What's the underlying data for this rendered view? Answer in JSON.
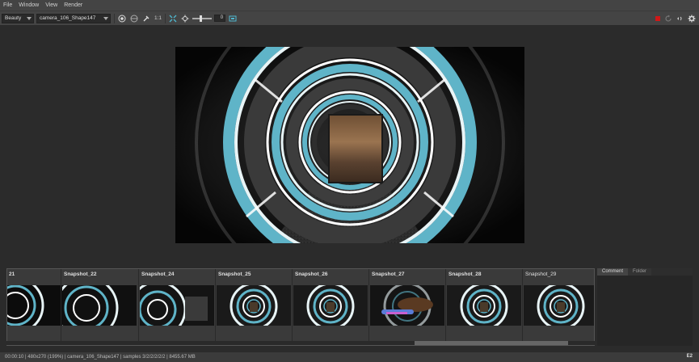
{
  "menu": {
    "items": [
      {
        "label": "File"
      },
      {
        "label": "Window"
      },
      {
        "label": "View"
      },
      {
        "label": "Render"
      }
    ]
  },
  "toolbar": {
    "aov_select": "Beauty",
    "camera_select": "camera_106_Shape147",
    "ratio_label": "1:1",
    "exposure_value": "0"
  },
  "snapshots": [
    {
      "label": "21"
    },
    {
      "label": "Snapshot_22"
    },
    {
      "label": "Snapshot_24"
    },
    {
      "label": "Snapshot_25"
    },
    {
      "label": "Snapshot_26"
    },
    {
      "label": "Snapshot_27"
    },
    {
      "label": "Snapshot_28"
    },
    {
      "label": "Snapshot_29"
    }
  ],
  "side_panel": {
    "tabs": [
      {
        "label": "Comment"
      },
      {
        "label": "Folder"
      }
    ]
  },
  "status": {
    "text": "00:00:10 | 480x270 (199%) | camera_106_Shape147 | samples 3/2/2/2/2/2 | 8455.67 MB",
    "right_label": "E2"
  },
  "colors": {
    "accent_cyan": "#5fb4c8",
    "stop_red": "#d01818"
  }
}
